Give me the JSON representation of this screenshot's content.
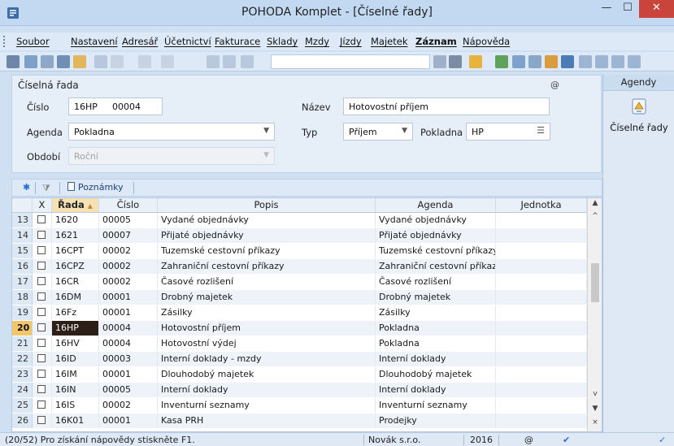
{
  "window": {
    "title": "POHODA Komplet - [Číselné řady]",
    "min_glyph": "—",
    "max_glyph": "☐",
    "close_glyph": "✕"
  },
  "menu": [
    "Soubor",
    "Nastavení",
    "Adresář",
    "Účetnictví",
    "Fakturace",
    "Sklady",
    "Mzdy",
    "Jízdy",
    "Majetek",
    "Záznam",
    "Nápověda"
  ],
  "form": {
    "header": "Číselná řada",
    "at_symbol": "@",
    "cislo_label": "Číslo",
    "cislo_prefix": "16HP",
    "cislo_number": "00004",
    "nazev_label": "Název",
    "nazev_value": "Hotovostní příjem",
    "agenda_label": "Agenda",
    "agenda_value": "Pokladna",
    "typ_label": "Typ",
    "typ_value": "Příjem",
    "pokladna_label": "Pokladna",
    "pokladna_value": "HP",
    "obdobi_label": "Období",
    "obdobi_value": "Roční"
  },
  "side_panel": {
    "header": "Agendy",
    "item_label": "Číselné řady"
  },
  "grid_tabs": {
    "notes_label": "Poznámky"
  },
  "grid": {
    "columns": [
      "X",
      "Řada",
      "Číslo",
      "Popis",
      "Agenda",
      "Jednotka"
    ],
    "rows": [
      {
        "n": "13",
        "rada": "1620",
        "cislo": "00005",
        "popis": "Vydané objednávky",
        "agenda": "Vydané objednávky",
        "jednotka": ""
      },
      {
        "n": "14",
        "rada": "1621",
        "cislo": "00007",
        "popis": "Přijaté objednávky",
        "agenda": "Přijaté objednávky",
        "jednotka": ""
      },
      {
        "n": "15",
        "rada": "16CPT",
        "cislo": "00002",
        "popis": "Tuzemské cestovní příkazy",
        "agenda": "Tuzemské cestovní příkazy",
        "jednotka": ""
      },
      {
        "n": "16",
        "rada": "16CPZ",
        "cislo": "00002",
        "popis": "Zahraniční cestovní příkazy",
        "agenda": "Zahraniční cestovní příkazy",
        "jednotka": ""
      },
      {
        "n": "17",
        "rada": "16CR",
        "cislo": "00002",
        "popis": "Časové rozlišení",
        "agenda": "Časové rozlišení",
        "jednotka": ""
      },
      {
        "n": "18",
        "rada": "16DM",
        "cislo": "00001",
        "popis": "Drobný majetek",
        "agenda": "Drobný majetek",
        "jednotka": ""
      },
      {
        "n": "19",
        "rada": "16Fz",
        "cislo": "00001",
        "popis": "Zásilky",
        "agenda": "Zásilky",
        "jednotka": ""
      },
      {
        "n": "20",
        "rada": "16HP",
        "cislo": "00004",
        "popis": "Hotovostní příjem",
        "agenda": "Pokladna",
        "jednotka": ""
      },
      {
        "n": "21",
        "rada": "16HV",
        "cislo": "00004",
        "popis": "Hotovostní výdej",
        "agenda": "Pokladna",
        "jednotka": ""
      },
      {
        "n": "22",
        "rada": "16ID",
        "cislo": "00003",
        "popis": "Interní doklady - mzdy",
        "agenda": "Interní doklady",
        "jednotka": ""
      },
      {
        "n": "23",
        "rada": "16IM",
        "cislo": "00001",
        "popis": "Dlouhodobý majetek",
        "agenda": "Dlouhodobý majetek",
        "jednotka": ""
      },
      {
        "n": "24",
        "rada": "16IN",
        "cislo": "00005",
        "popis": "Interní doklady",
        "agenda": "Interní doklady",
        "jednotka": ""
      },
      {
        "n": "25",
        "rada": "16IS",
        "cislo": "00002",
        "popis": "Inventurní seznamy",
        "agenda": "Inventurní seznamy",
        "jednotka": ""
      },
      {
        "n": "26",
        "rada": "16K01",
        "cislo": "00001",
        "popis": "Kasa PRH",
        "agenda": "Prodejky",
        "jednotka": ""
      }
    ],
    "selected_index": 7
  },
  "status": {
    "help": "(20/52) Pro získání nápovědy stiskněte F1.",
    "company": "Novák s.r.o.",
    "year": "2016"
  }
}
